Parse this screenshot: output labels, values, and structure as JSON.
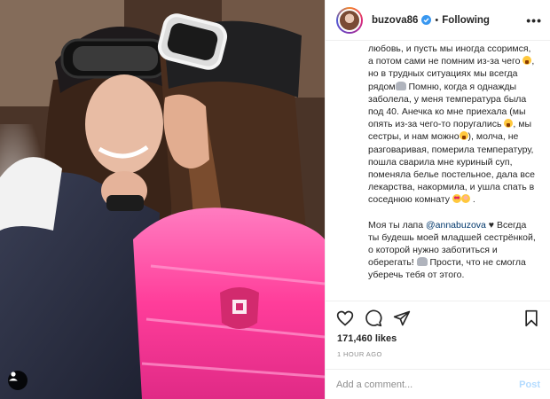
{
  "post": {
    "username": "buzova86",
    "follow_separator": "•",
    "follow_label": "Following",
    "more_label": "•••",
    "caption_para1": "любовь, и пусть мы иногда ссоримся, а потом сами не помним из-за чего",
    "caption_para1b": ", но в трудных ситуациях мы всегда рядом",
    "caption_para1c": " Помню, когда я однажды заболела, у меня температура была под 40. Анечка ко мне приехала (мы опять из-за чего-то поругались",
    "caption_para1d": ", мы сестры, и нам можно",
    "caption_para1e": "), молча, не разговаривая, померила температуру, пошла сварила мне куриный суп, поменяла белье постельное, дала все лекарства, накормила, и ушла спать в соседнюю комнату",
    "caption_para1f": ".",
    "caption_para2a": "Моя ты лапа ",
    "caption_mention": "@annabuzova",
    "caption_para2b": " ♥ Всегда ты будешь моей младшей сестрёнкой, о которой нужно заботиться и оберегать!",
    "caption_para2c": " Прости, что не смогла уберечь тебя от этого.",
    "likes": "171,460 likes",
    "time": "1 HOUR AGO",
    "comment_placeholder": "Add a comment...",
    "post_label": "Post"
  },
  "colors": {
    "accent_link": "#00376b",
    "post_disabled": "#b3dbff",
    "verified": "#3897f0",
    "jacket_pink": "#ff4fa3",
    "jacket_dark": "#2b2f3f"
  },
  "icons": {
    "like": "heart-icon",
    "comment": "comment-icon",
    "share": "paper-plane-icon",
    "save": "bookmark-icon",
    "verified": "verified-badge-icon",
    "tags": "user-tag-icon"
  }
}
